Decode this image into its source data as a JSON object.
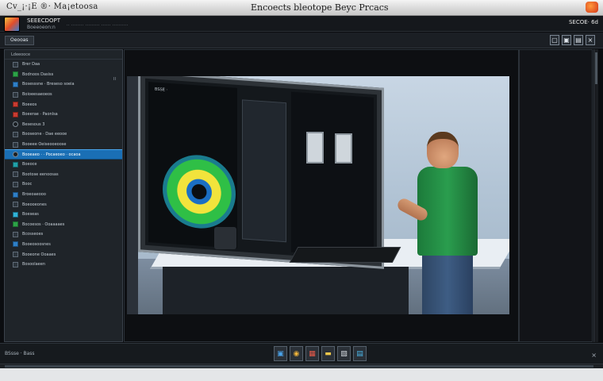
{
  "window": {
    "app_name": "Cv_¡·¡E ®· Ma¡etoosa",
    "title": "Encoects bleotope Beyc Prcacs"
  },
  "menu": {
    "line1": "SEEECDOPT",
    "line2": "Boeeoeon:n",
    "menu_path": "·· ········ ········· ······ ··········",
    "right_label": "SECOE· 6d"
  },
  "toolbar": {
    "left_tab": "Oeooas",
    "window_buttons": [
      "▢",
      "▣",
      "▤",
      "×"
    ]
  },
  "sidebar": {
    "header": "Ldeeooce",
    "marker": "II",
    "items": [
      {
        "label": "Brer Daa",
        "icon": "file-icon",
        "color": ""
      },
      {
        "label": "Bodnoos Dasiss",
        "icon": "folder-icon",
        "color": "green"
      },
      {
        "label": "Bosesssne · Breseso soeia",
        "icon": "display-icon",
        "color": "blue"
      },
      {
        "label": "Boioeesaeoeos",
        "icon": "document-icon",
        "color": ""
      },
      {
        "label": "Boeeos",
        "icon": "flag-icon",
        "color": "red"
      },
      {
        "label": "Boeerae · Paonlsa",
        "icon": "lock-icon",
        "color": "red"
      },
      {
        "label": "Besesous 3",
        "icon": "eye-icon",
        "color": "ring"
      },
      {
        "label": "Booseone · Dae eeooe",
        "icon": "image-icon",
        "color": ""
      },
      {
        "label": "Booeee Oeiseooeoose",
        "icon": "gear-icon",
        "color": ""
      },
      {
        "label": "Booeaeo · · Pocaeoeo · ocaoa",
        "icon": "globe-icon",
        "color": "ring"
      },
      {
        "label": "Boeoce",
        "icon": "star-icon",
        "color": "teal"
      },
      {
        "label": "Bootose eenoosas",
        "icon": "bookmark-icon",
        "color": ""
      },
      {
        "label": "Booc",
        "icon": "tag-icon",
        "color": ""
      },
      {
        "label": "Broeoaeooo",
        "icon": "mail-icon",
        "color": "blue"
      },
      {
        "label": "Boeooeones",
        "icon": "link-icon",
        "color": ""
      },
      {
        "label": "Boeseas",
        "icon": "cloud-icon",
        "color": "cyan"
      },
      {
        "label": "Bocoesos · Ooaaaaes",
        "icon": "chart-icon",
        "color": "green"
      },
      {
        "label": "Bcosseoes",
        "icon": "clock-icon",
        "color": ""
      },
      {
        "label": "Booeosoosnes",
        "icon": "user-icon",
        "color": "blue"
      },
      {
        "label": "Booeone Ooaaes",
        "icon": "database-icon",
        "color": ""
      },
      {
        "label": "Bosoolaeen",
        "icon": "key-icon",
        "color": ""
      }
    ],
    "selected_index": 9
  },
  "viewer": {
    "screen_label": "BSSE ·"
  },
  "bottom": {
    "status": "BSsse · Bass",
    "tools": [
      "▣",
      "◉",
      "▦",
      "▬",
      "▧",
      "▤"
    ],
    "corner_mark": "×"
  }
}
